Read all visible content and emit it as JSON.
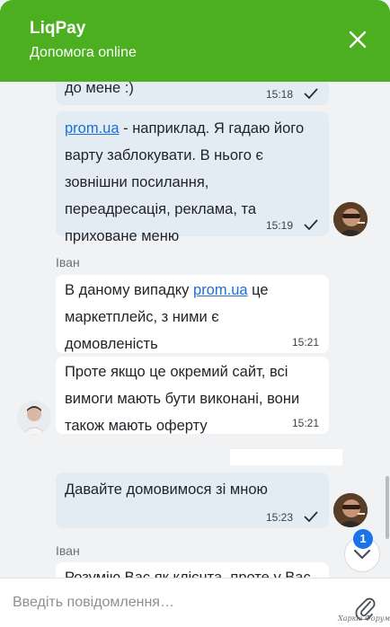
{
  "header": {
    "title": "LiqPay",
    "subtitle": "Допомога online"
  },
  "messages": [
    {
      "text": "до мене :)",
      "time": "15:18"
    },
    {
      "link": "prom.ua",
      "text_after_link": " - наприклад. Я гадаю його\nварту заблокувати. В нього є\nзовнішни посилання,\nпереадресація, реклама, та\nприховане меню",
      "time": "15:19"
    },
    {
      "sender": "Іван"
    },
    {
      "text_before_link": "В даному випадку ",
      "link": "prom.ua",
      "text_after_link": "  це\nмаркетплейс, з ними є\nдомовленість",
      "time": "15:21"
    },
    {
      "text": "Проте якщо це окремий сайт, всі\nвимоги мають бути виконані, вони\nтакож мають оферту",
      "time": "15:21"
    },
    {
      "text": "Давайте домовимося зі мною",
      "time": "15:23"
    },
    {
      "sender": "Іван"
    },
    {
      "text": "Розумію Вас як клієнта, проте у Вас"
    }
  ],
  "scroll_button": {
    "unread_count": "1"
  },
  "composer": {
    "placeholder": "Введіть повідомлення…"
  },
  "watermark": "Харків Форум",
  "colors": {
    "header": "#4caf20",
    "outgoing_bubble": "#e4ecf3",
    "incoming_bubble": "#ffffff",
    "link": "#1c6fd6",
    "badge": "#1a73e8"
  }
}
